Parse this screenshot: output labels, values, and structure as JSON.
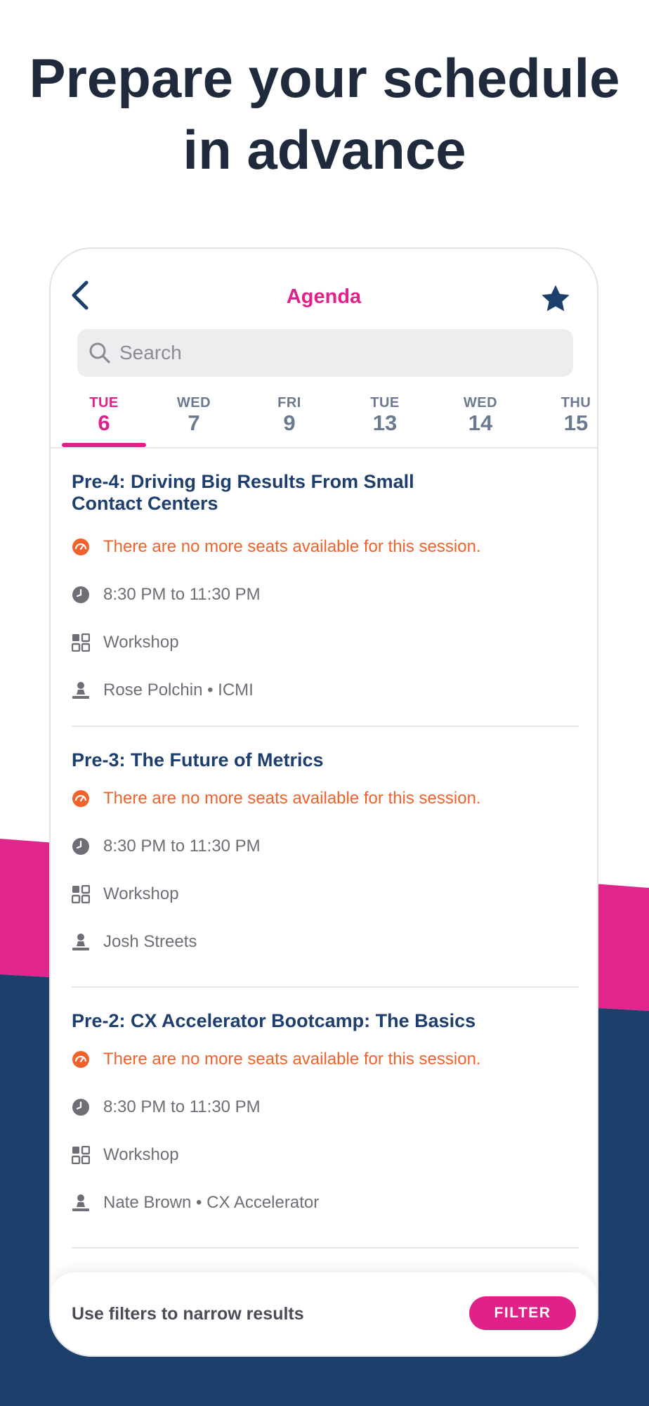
{
  "headline": "Prepare your schedule\nin advance",
  "colors": {
    "brand_pink": "#e0218a",
    "navy": "#1c3f6b",
    "title_blue": "#1e3e6d",
    "warning_orange": "#f0622c",
    "muted_gray": "#6e6f76"
  },
  "navbar": {
    "back_icon": "chevron-left-icon",
    "title": "Agenda",
    "favorites_icon": "star-icon"
  },
  "search": {
    "placeholder": "Search",
    "icon": "search-icon"
  },
  "days": [
    {
      "dow": "TUE",
      "num": "6",
      "active": true
    },
    {
      "dow": "WED",
      "num": "7",
      "active": false
    },
    {
      "dow": "FRI",
      "num": "9",
      "active": false
    },
    {
      "dow": "TUE",
      "num": "13",
      "active": false
    },
    {
      "dow": "WED",
      "num": "14",
      "active": false
    },
    {
      "dow": "THU",
      "num": "15",
      "active": false
    }
  ],
  "sessions": [
    {
      "title": "Pre-4: Driving Big Results From Small Contact Centers",
      "availability": "There are no more seats available for this session.",
      "time": "8:30 PM to 11:30 PM",
      "type": "Workshop",
      "speaker": "Rose Polchin • ICMI"
    },
    {
      "title": "Pre-3: The Future of Metrics",
      "availability": "There are no more seats available for this session.",
      "time": "8:30 PM to 11:30 PM",
      "type": "Workshop",
      "speaker": "Josh Streets"
    },
    {
      "title": "Pre-2: CX Accelerator Bootcamp: The Basics",
      "availability": "There are no more seats available for this session.",
      "time": "8:30 PM to 11:30 PM",
      "type": "Workshop",
      "speaker": "Nate Brown • CX Accelerator"
    }
  ],
  "row_icons": {
    "availability": "speedometer-icon",
    "time": "clock-icon",
    "type": "category-grid-icon",
    "speaker": "speaker-icon"
  },
  "bottom_bar": {
    "hint": "Use filters to narrow results",
    "filter_label": "FILTER"
  }
}
